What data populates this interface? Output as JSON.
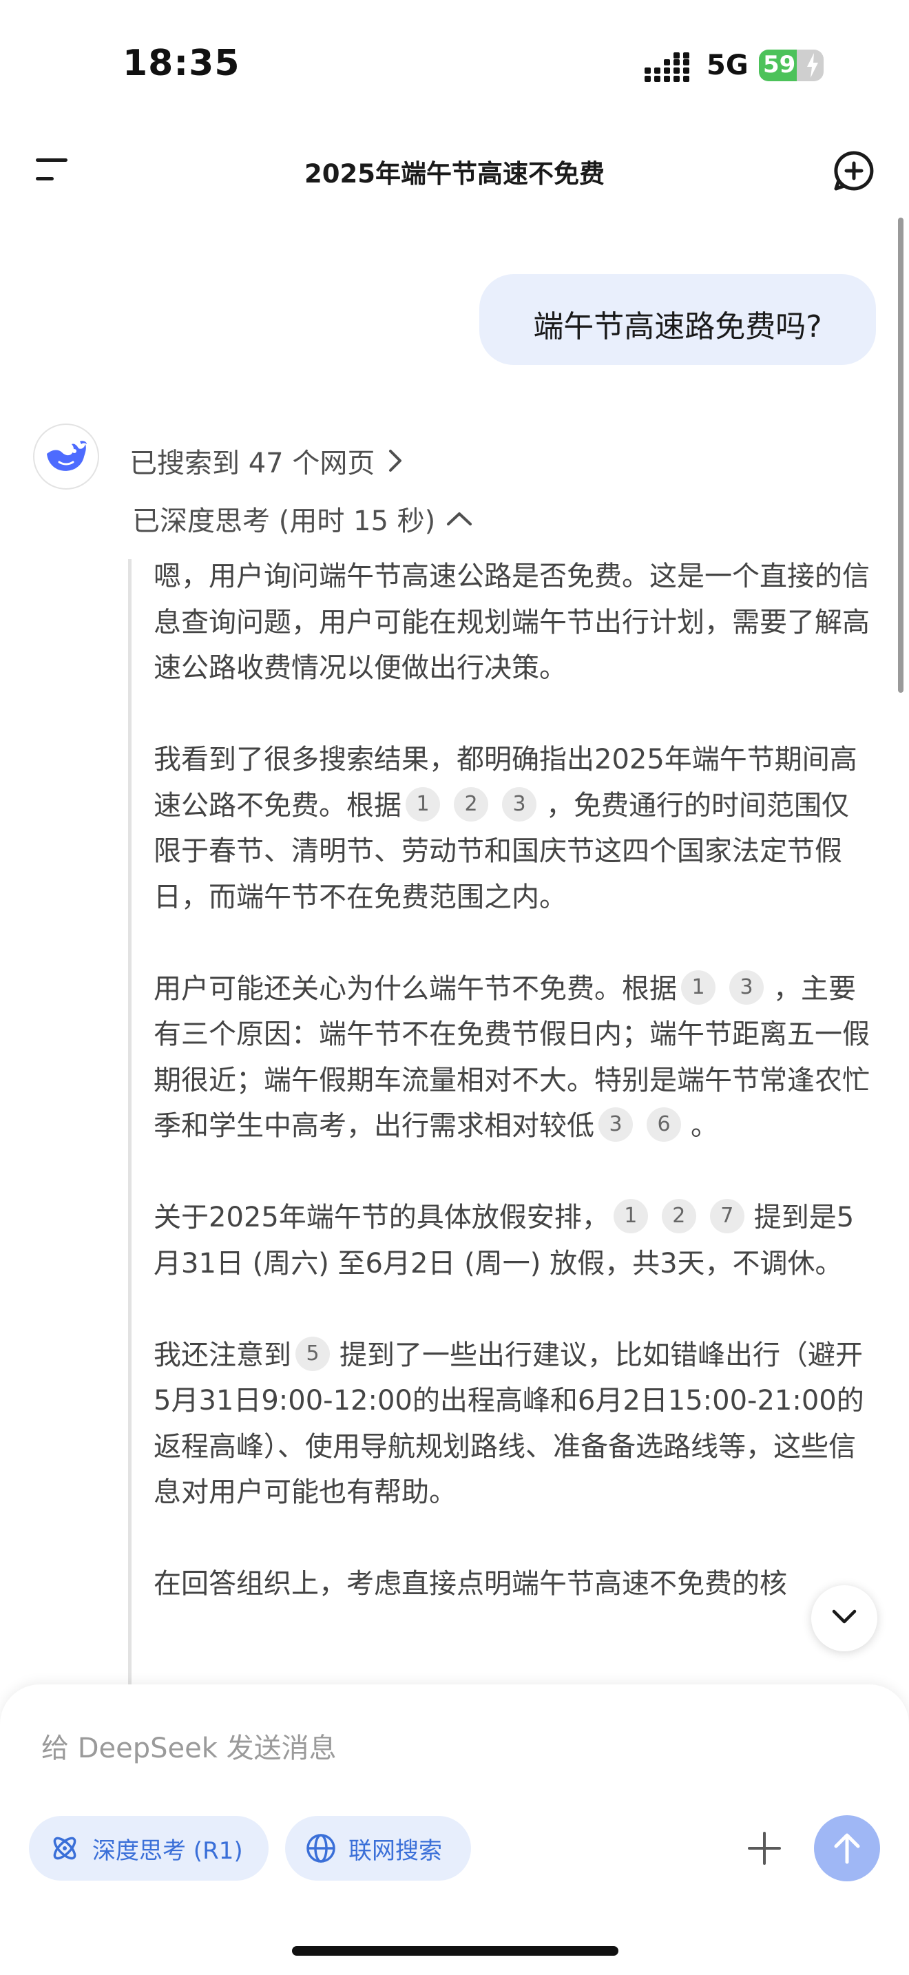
{
  "status_bar": {
    "time": "18:35",
    "network": "5G",
    "battery": "59",
    "battery_level": 0.59
  },
  "header": {
    "title": "2025年端午节高速不免费"
  },
  "user_message": "端午节高速路免费吗?",
  "assistant": {
    "searched_label": "已搜索到 47 个网页",
    "thought_label": "已深度思考 (用时 15 秒)",
    "thinking": [
      {
        "segments": [
          {
            "text": "嗯，用户询问端午节高速公路是否免费。这是一个直接的信息查询问题，用户可能在规划端午节出行计划，需要了解高速公路收费情况以便做出行决策。"
          }
        ]
      },
      {
        "segments": [
          {
            "text": "我看到了很多搜索结果，都明确指出2025年端午节期间高速公路不免费。根据"
          },
          {
            "cite": "1"
          },
          {
            "cite": "2"
          },
          {
            "cite": "3"
          },
          {
            "text": "，免费通行的时间范围仅限于春节、清明节、劳动节和国庆节这四个国家法定节假日，而端午节不在免费范围之内。"
          }
        ]
      },
      {
        "segments": [
          {
            "text": "用户可能还关心为什么端午节不免费。根据"
          },
          {
            "cite": "1"
          },
          {
            "cite": "3"
          },
          {
            "text": "，主要有三个原因：端午节不在免费节假日内；端午节距离五一假期很近；端午假期车流量相对不大。特别是端午节常逢农忙季和学生中高考，出行需求相对较低"
          },
          {
            "cite": "3"
          },
          {
            "cite": "6"
          },
          {
            "text": "。"
          }
        ]
      },
      {
        "segments": [
          {
            "text": "关于2025年端午节的具体放假安排，"
          },
          {
            "cite": "1"
          },
          {
            "cite": "2"
          },
          {
            "cite": "7"
          },
          {
            "text": "提到是5月31日 (周六) 至6月2日 (周一) 放假，共3天，不调休。"
          }
        ]
      },
      {
        "segments": [
          {
            "text": "我还注意到"
          },
          {
            "cite": "5"
          },
          {
            "text": "提到了一些出行建议，比如错峰出行（避开5月31日9:00-12:00的出程高峰和6月2日15:00-21:00的返程高峰）、使用导航规划路线、准备备选路线等，这些信息对用户可能也有帮助。"
          }
        ]
      },
      {
        "segments": [
          {
            "text": "在回答组织上，考虑直接点明端午节高速不免费的核"
          }
        ]
      }
    ]
  },
  "composer": {
    "placeholder": "给 DeepSeek 发送消息",
    "deep_think_label": "深度思考 (R1)",
    "web_search_label": "联网搜索"
  },
  "colors": {
    "accent": "#3a6fd8",
    "bubble": "#e9effc",
    "send_button": "#9fb7f5",
    "battery": "#4cc25a"
  },
  "icons": [
    "signal-icon",
    "battery-bolt-icon",
    "menu-icon",
    "new-chat-icon",
    "deepseek-whale-icon",
    "chevron-right-icon",
    "chevron-up-icon",
    "chevron-down-icon",
    "atom-icon",
    "globe-icon",
    "plus-icon",
    "arrow-up-icon"
  ]
}
